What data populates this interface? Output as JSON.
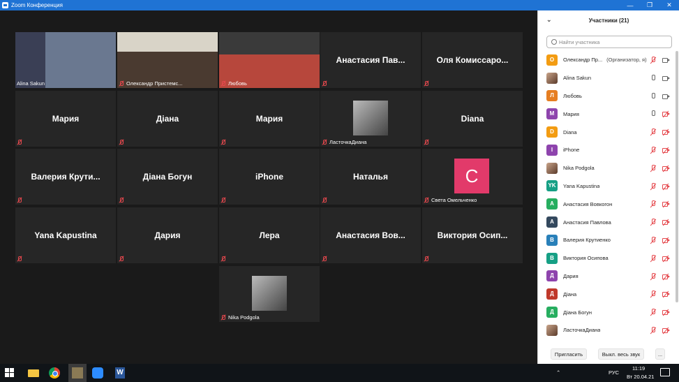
{
  "window": {
    "title": "Zoom Конференция",
    "min": "—",
    "restore": "❐",
    "close": "✕"
  },
  "tiles": [
    {
      "label": "Alina Sakun",
      "type": "video"
    },
    {
      "label": "Олександр Пристемс...",
      "type": "video"
    },
    {
      "label": "Любовь",
      "type": "video"
    },
    {
      "name": "Анастасия  Пав..."
    },
    {
      "name": "Оля  Комиссаро..."
    },
    {
      "name": "Мария"
    },
    {
      "name": "Діана"
    },
    {
      "name": "Мария"
    },
    {
      "label": "ЛасточкаДиана",
      "type": "photo"
    },
    {
      "name": "Diana"
    },
    {
      "name": "Валерия  Крути..."
    },
    {
      "name": "Діана Богун"
    },
    {
      "name": "iPhone"
    },
    {
      "name": "Наталья"
    },
    {
      "label": "Света Омельченко",
      "avatar": "C"
    },
    {
      "name": "Yana Kapustina"
    },
    {
      "name": "Дария"
    },
    {
      "name": "Лера"
    },
    {
      "name": "Анастасия  Вов..."
    },
    {
      "name": "Виктория  Осип..."
    },
    {
      "label": "Nika Podgola",
      "type": "photo"
    }
  ],
  "participants": {
    "title": "Участники (21)",
    "search_placeholder": "Найти участника",
    "items": [
      {
        "initial": "О",
        "color": "#f39c12",
        "name": "Олександр Пр...",
        "role": "(Организатор, я)",
        "mic": "off",
        "cam": "on"
      },
      {
        "initial": "",
        "color": "",
        "name": "Alina Sakun",
        "mic": "on",
        "cam": "on",
        "img": true
      },
      {
        "initial": "Л",
        "color": "#e67e22",
        "name": "Любовь",
        "mic": "on",
        "cam": "on"
      },
      {
        "initial": "М",
        "color": "#8e44ad",
        "name": "Мария",
        "mic": "on",
        "cam": "off"
      },
      {
        "initial": "D",
        "color": "#f39c12",
        "name": "Diana",
        "mic": "off",
        "cam": "off"
      },
      {
        "initial": "I",
        "color": "#8e44ad",
        "name": "iPhone",
        "mic": "off",
        "cam": "off"
      },
      {
        "initial": "",
        "color": "",
        "name": "Nika Podgola",
        "mic": "off",
        "cam": "off",
        "img": true
      },
      {
        "initial": "YK",
        "color": "#16a085",
        "name": "Yana Kapustina",
        "mic": "off",
        "cam": "off"
      },
      {
        "initial": "А",
        "color": "#27ae60",
        "name": "Анастасия Вовкогон",
        "mic": "off",
        "cam": "off"
      },
      {
        "initial": "А",
        "color": "#34495e",
        "name": "Анастасия Павлова",
        "mic": "off",
        "cam": "off"
      },
      {
        "initial": "В",
        "color": "#2980b9",
        "name": "Валерия Крутиенко",
        "mic": "off",
        "cam": "off"
      },
      {
        "initial": "В",
        "color": "#16a085",
        "name": "Виктория Осипова",
        "mic": "off",
        "cam": "off"
      },
      {
        "initial": "Д",
        "color": "#8e44ad",
        "name": "Дария",
        "mic": "off",
        "cam": "off"
      },
      {
        "initial": "Д",
        "color": "#c0392b",
        "name": "Діана",
        "mic": "off",
        "cam": "off"
      },
      {
        "initial": "Д",
        "color": "#27ae60",
        "name": "Діана Богун",
        "mic": "off",
        "cam": "off"
      },
      {
        "initial": "",
        "color": "",
        "name": "ЛасточкаДиана",
        "mic": "off",
        "cam": "off",
        "img": true
      }
    ],
    "invite": "Пригласить",
    "mute_all": "Выкл. весь звук",
    "more": "..."
  },
  "taskbar": {
    "lang": "РУС",
    "time": "11:19",
    "date": "Вт 20.04.21"
  }
}
